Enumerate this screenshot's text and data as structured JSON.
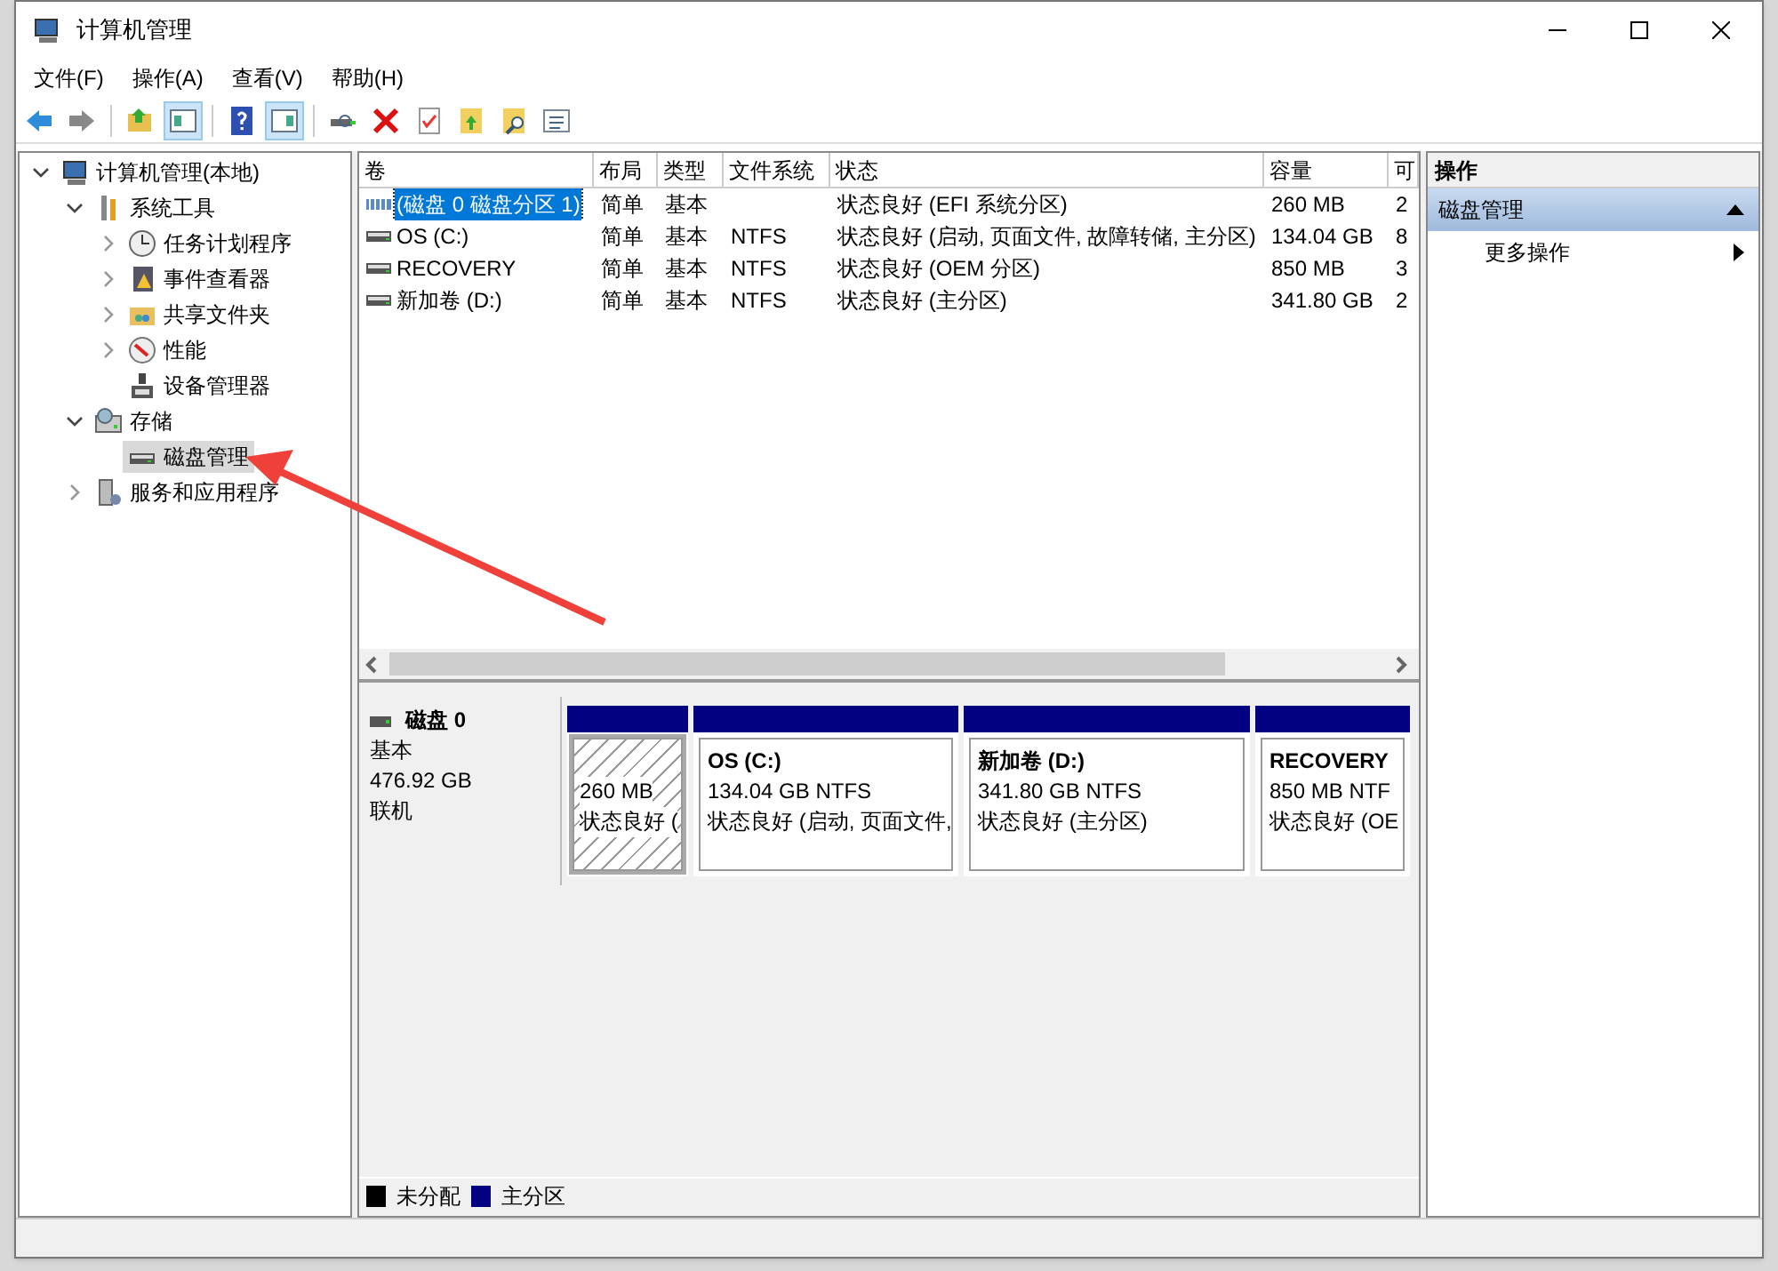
{
  "window": {
    "title": "计算机管理"
  },
  "menu": [
    "文件(F)",
    "操作(A)",
    "查看(V)",
    "帮助(H)"
  ],
  "toolbar": [
    {
      "kind": "back",
      "pressed": false
    },
    {
      "kind": "forward",
      "pressed": false
    },
    {
      "kind": "separator"
    },
    {
      "kind": "up",
      "pressed": false
    },
    {
      "kind": "tree",
      "pressed": true
    },
    {
      "kind": "separator"
    },
    {
      "kind": "help",
      "pressed": false
    },
    {
      "kind": "pane",
      "pressed": true
    },
    {
      "kind": "separator"
    },
    {
      "kind": "connect",
      "pressed": false
    },
    {
      "kind": "delete",
      "pressed": false
    },
    {
      "kind": "properties",
      "pressed": false
    },
    {
      "kind": "export",
      "pressed": false
    },
    {
      "kind": "find",
      "pressed": false
    },
    {
      "kind": "list",
      "pressed": false
    }
  ],
  "tree": [
    {
      "label": "计算机管理(本地)",
      "kind": "computer",
      "expanded": true,
      "selected": false,
      "children": [
        {
          "label": "系统工具",
          "kind": "tools",
          "expanded": true,
          "selected": false,
          "children": [
            {
              "label": "任务计划程序",
              "kind": "clock",
              "expanded": false,
              "selected": false
            },
            {
              "label": "事件查看器",
              "kind": "log",
              "expanded": false,
              "selected": false
            },
            {
              "label": "共享文件夹",
              "kind": "folder",
              "expanded": false,
              "selected": false
            },
            {
              "label": "性能",
              "kind": "gauge",
              "expanded": false,
              "selected": false
            },
            {
              "label": "设备管理器",
              "kind": "device",
              "selected": false
            }
          ]
        },
        {
          "label": "存储",
          "kind": "storage",
          "expanded": true,
          "selected": false,
          "children": [
            {
              "label": "磁盘管理",
              "kind": "drive",
              "selected": true
            }
          ]
        },
        {
          "label": "服务和应用程序",
          "kind": "services",
          "expanded": false,
          "selected": false
        }
      ]
    }
  ],
  "table": {
    "columns": [
      "卷",
      "布局",
      "类型",
      "文件系统",
      "状态",
      "容量",
      "可"
    ],
    "rows": [
      {
        "kind": "efi",
        "selected": true,
        "cells": [
          "(磁盘 0 磁盘分区 1)",
          "简单",
          "基本",
          "",
          "状态良好 (EFI 系统分区)",
          "260 MB",
          "2"
        ]
      },
      {
        "kind": "drive",
        "selected": false,
        "cells": [
          "OS (C:)",
          "简单",
          "基本",
          "NTFS",
          "状态良好 (启动, 页面文件, 故障转储, 主分区)",
          "134.04 GB",
          "8"
        ]
      },
      {
        "kind": "drive",
        "selected": false,
        "cells": [
          "RECOVERY",
          "简单",
          "基本",
          "NTFS",
          "状态良好 (OEM 分区)",
          "850 MB",
          "3"
        ]
      },
      {
        "kind": "drive",
        "selected": false,
        "cells": [
          "新加卷 (D:)",
          "简单",
          "基本",
          "NTFS",
          "状态良好 (主分区)",
          "341.80 GB",
          "2"
        ]
      }
    ]
  },
  "disk": {
    "name": "磁盘 0",
    "type": "基本",
    "size": "476.92 GB",
    "status": "联机",
    "partitions": [
      {
        "selected": true,
        "size": "260 MB",
        "status": "状态良好 ("
      },
      {
        "selected": false,
        "title": "OS  (C:)",
        "size": "134.04 GB NTFS",
        "status": "状态良好 (启动, 页面文件,"
      },
      {
        "selected": false,
        "title": "新加卷  (D:)",
        "size": "341.80 GB NTFS",
        "status": "状态良好 (主分区)"
      },
      {
        "selected": false,
        "title": "RECOVERY",
        "size": "850 MB NTF",
        "status": "状态良好 (OE"
      }
    ]
  },
  "legend": [
    {
      "label": "未分配",
      "color": "#000000"
    },
    {
      "label": "主分区",
      "color": "#000080"
    }
  ],
  "actions": {
    "title": "操作",
    "section": {
      "label": "磁盘管理",
      "expanded": true
    },
    "items": [
      "更多操作"
    ]
  }
}
